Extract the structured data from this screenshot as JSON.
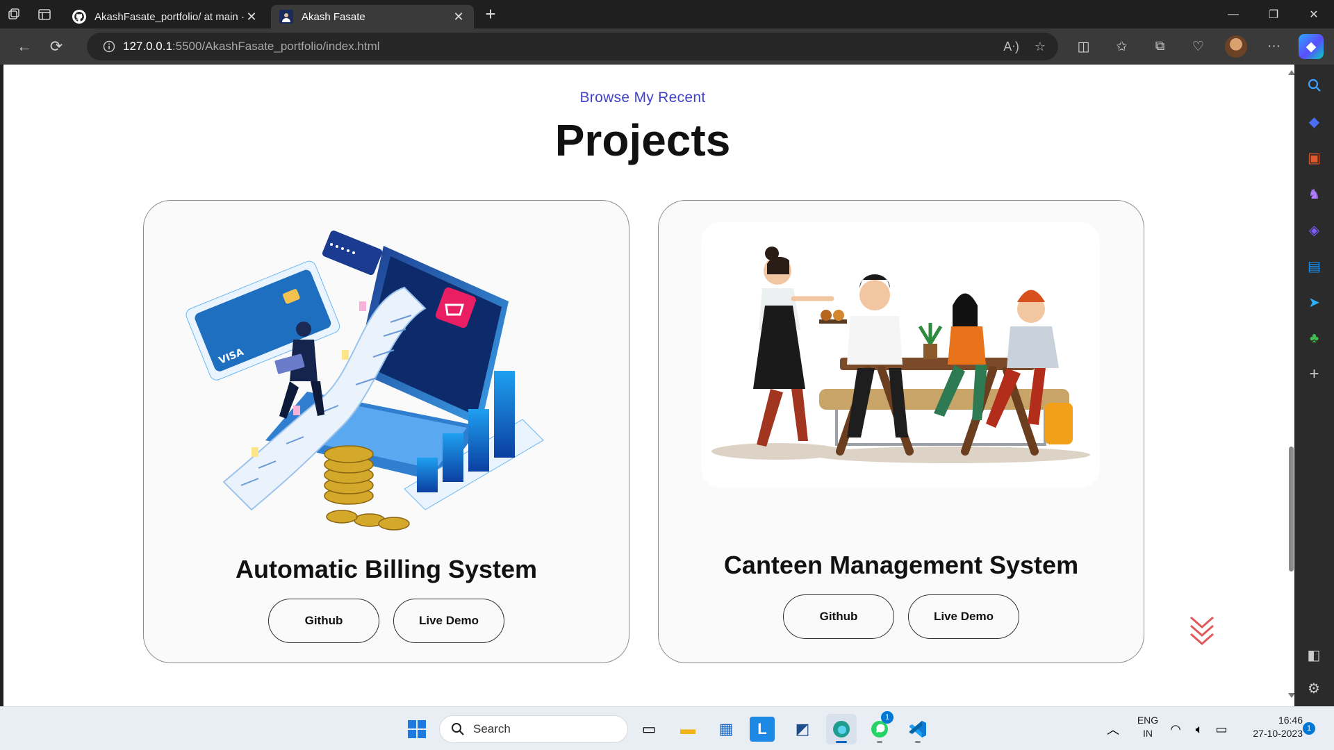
{
  "browser": {
    "tabs": [
      {
        "title": "AkashFasate_portfolio/ at main ·",
        "active": false,
        "favicon": "github-icon"
      },
      {
        "title": "Akash Fasate",
        "active": true,
        "favicon": "profile-icon"
      }
    ],
    "url": {
      "host": "127.0.0.1",
      "path": ":5500/AkashFasate_portfolio/index.html"
    }
  },
  "page": {
    "subtitle": "Browse My Recent",
    "title": "Projects",
    "projects": [
      {
        "name": "Automatic Billing System",
        "github_label": "Github",
        "demo_label": "Live Demo",
        "image": "billing-illustration"
      },
      {
        "name": "Canteen Management System",
        "github_label": "Github",
        "demo_label": "Live Demo",
        "image": "canteen-illustration"
      }
    ]
  },
  "taskbar": {
    "search_placeholder": "Search",
    "whatsapp_badge": "1",
    "lang_line1": "ENG",
    "lang_line2": "IN",
    "time": "16:46",
    "date": "27-10-2023",
    "notification_count": "1"
  },
  "colors": {
    "accent": "#3f43c9",
    "text": "#111111",
    "card_bg": "#fafafa"
  }
}
